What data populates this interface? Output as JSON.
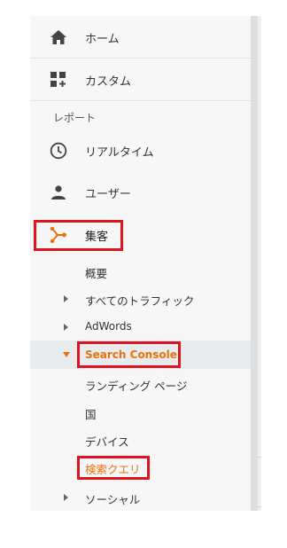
{
  "nav": {
    "home": {
      "label": "ホーム",
      "icon": "home-icon"
    },
    "custom": {
      "label": "カスタム",
      "icon": "dashboard-icon"
    },
    "section_label": "レポート",
    "realtime": {
      "label": "リアルタイム",
      "icon": "clock-icon"
    },
    "users": {
      "label": "ユーザー",
      "icon": "person-icon"
    },
    "acquisition": {
      "label": "集客",
      "icon": "acquisition-icon"
    }
  },
  "acquisition_items": {
    "overview": "概要",
    "all_traffic": "すべてのトラフィック",
    "adwords": "AdWords",
    "search_console": "Search Console",
    "landing_pages": "ランディング ページ",
    "countries": "国",
    "devices": "デバイス",
    "queries": "検索クエリ",
    "social": "ソーシャル"
  },
  "colors": {
    "accent": "#e8710a",
    "highlight_box": "#e0141e",
    "selected_row": "#e9ecef"
  }
}
